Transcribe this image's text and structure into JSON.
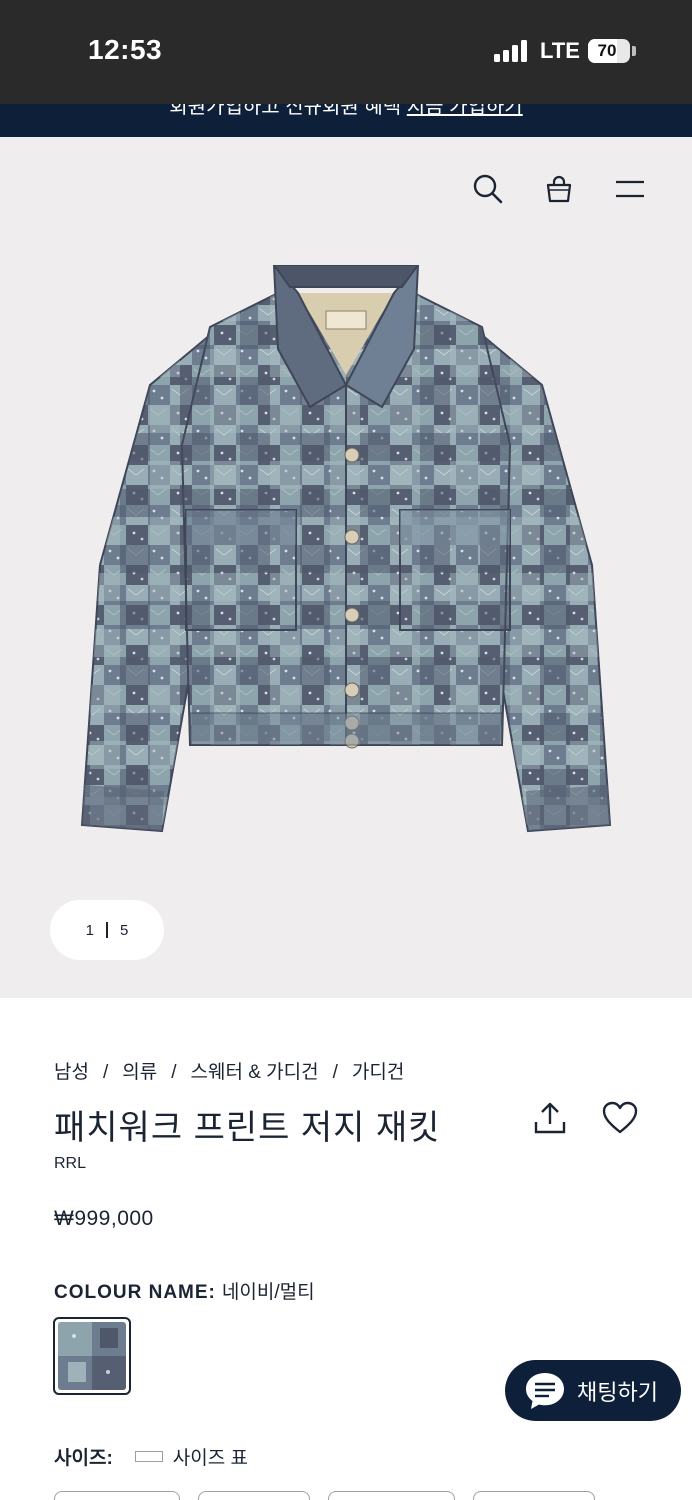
{
  "status_bar": {
    "time": "12:53",
    "network": "LTE",
    "battery": "70",
    "battery_level": 0.7
  },
  "promo_banner": {
    "text": "회원가입하고 신규회원 혜택 ",
    "link": "지금 가입하기"
  },
  "header": {
    "icons": [
      "search-icon",
      "shopping-bag-icon",
      "menu-icon"
    ]
  },
  "gallery": {
    "current": "1",
    "total": "5"
  },
  "breadcrumb": [
    "남성",
    "의류",
    "스웨터 & 가디건",
    "가디건"
  ],
  "product": {
    "title": "패치워크 프린트 저지 재킷",
    "brand": "RRL",
    "price": "₩999,000"
  },
  "colour": {
    "label": "COLOUR NAME:",
    "value": "네이비/멀티"
  },
  "chat": {
    "label": "채팅하기"
  },
  "size": {
    "label": "사이즈:",
    "chart_link": "사이즈 표"
  },
  "colors": {
    "navy": "#0e1f3a",
    "text": "#1b2433",
    "gallery_bg": "#efeded"
  }
}
